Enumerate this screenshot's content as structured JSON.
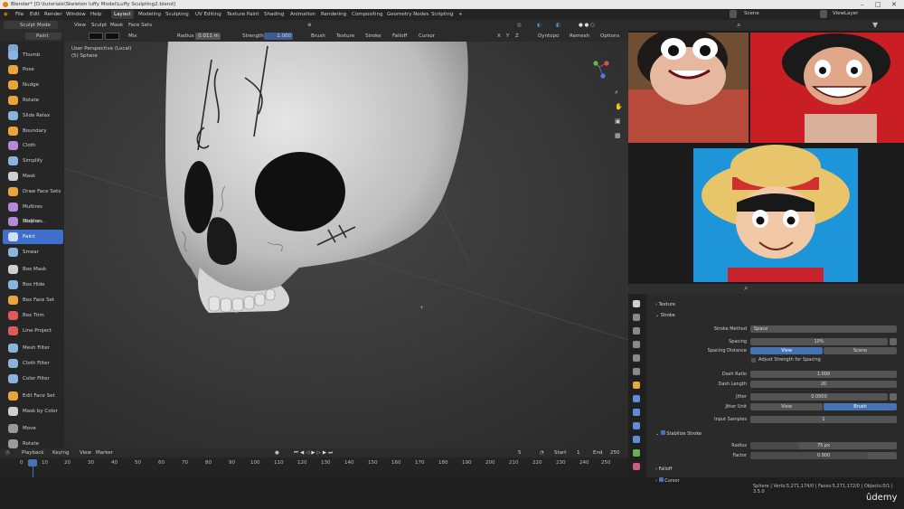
{
  "title_bar": {
    "text": "Blender* [D:\\tutorials\\Skeleton luffy Model\\Luffy Sculpting2.blend]"
  },
  "menu": [
    "File",
    "Edit",
    "Render",
    "Window",
    "Help"
  ],
  "workspaces": [
    "Layout",
    "Modeling",
    "Sculpting",
    "UV Editing",
    "Texture Paint",
    "Shading",
    "Animation",
    "Rendering",
    "Compositing",
    "Geometry Nodes",
    "Scripting"
  ],
  "active_workspace": "Layout",
  "scene": {
    "scene_label": "Scene",
    "view_layer": "ViewLayer"
  },
  "header": {
    "mode": "Sculpt Mode",
    "view": "View",
    "sculpt": "Sculpt",
    "mask": "Mask",
    "face_sets": "Face Sets"
  },
  "sub_header": {
    "brush": "Paint",
    "blend": "Mix",
    "radius_label": "Radius",
    "radius_value": "0.011 m",
    "strength_label": "Strength",
    "strength_value": "1.000",
    "menus": [
      "Brush",
      "Texture",
      "Stroke",
      "Falloff",
      "Cursor"
    ],
    "axes": [
      "X",
      "Y",
      "Z"
    ],
    "dyntopo": "Dyntopo",
    "remesh": "Remesh",
    "options": "Options"
  },
  "viewport": {
    "line1": "User Perspective (Local)",
    "line2": "(5) Sphere"
  },
  "tools": [
    "",
    "Thumb",
    "Pose",
    "Nudge",
    "Rotate",
    "Slide Relax",
    "Boundary",
    "Cloth",
    "Simplify",
    "Mask",
    "Draw Face Sets",
    "Multires Displac...",
    "Multires Displac...",
    "Paint",
    "Smear",
    "Box Mask",
    "Box Hide",
    "Box Face Set",
    "Box Trim",
    "Line Project",
    "Mesh Filter",
    "Cloth Filter",
    "Color Filter",
    "Edit Face Set",
    "Mask by Color",
    "Move",
    "Rotate"
  ],
  "active_tool": "Paint",
  "timeline": {
    "menus": [
      "Playback",
      "Keying",
      "View",
      "Marker"
    ],
    "current_frame": "5",
    "start_label": "Start",
    "start": "1",
    "end_label": "End",
    "end": "250",
    "ruler": [
      "0",
      "10",
      "20",
      "30",
      "40",
      "50",
      "60",
      "70",
      "80",
      "90",
      "100",
      "110",
      "120",
      "130",
      "140",
      "150",
      "160",
      "170",
      "180",
      "190",
      "200",
      "210",
      "220",
      "230",
      "240",
      "250"
    ]
  },
  "properties": {
    "texture": "Texture",
    "stroke": "Stroke",
    "stroke_method_label": "Stroke Method",
    "stroke_method": "Space",
    "spacing_label": "Spacing",
    "spacing": "10%",
    "spacing_distance_label": "Spacing Distance",
    "sd_view": "View",
    "sd_scene": "Scene",
    "adjust_strength": "Adjust Strength for Spacing",
    "dash_ratio_label": "Dash Ratio",
    "dash_ratio": "1.000",
    "dash_length_label": "Dash Length",
    "dash_length": "20",
    "jitter_label": "Jitter",
    "jitter": "0.0000",
    "jitter_unit_label": "Jitter Unit",
    "ju_view": "View",
    "ju_brush": "Brush",
    "input_samples_label": "Input Samples",
    "input_samples": "1",
    "stabilize": "Stabilize Stroke",
    "radius_label": "Radius",
    "radius": "75 px",
    "factor_label": "Factor",
    "factor": "0.900",
    "falloff": "Falloff",
    "cursor": "Cursor"
  },
  "status": {
    "text": "Sphere | Verts:5,271,174/0 | Faces:5,271,172/0 | Objects:0/1 | 3.5.0",
    "watermark": "ûdemy"
  },
  "colors": {
    "accent": "#4772b3",
    "active_tool": "#3f6fcb",
    "bg": "#1d1d1d"
  }
}
